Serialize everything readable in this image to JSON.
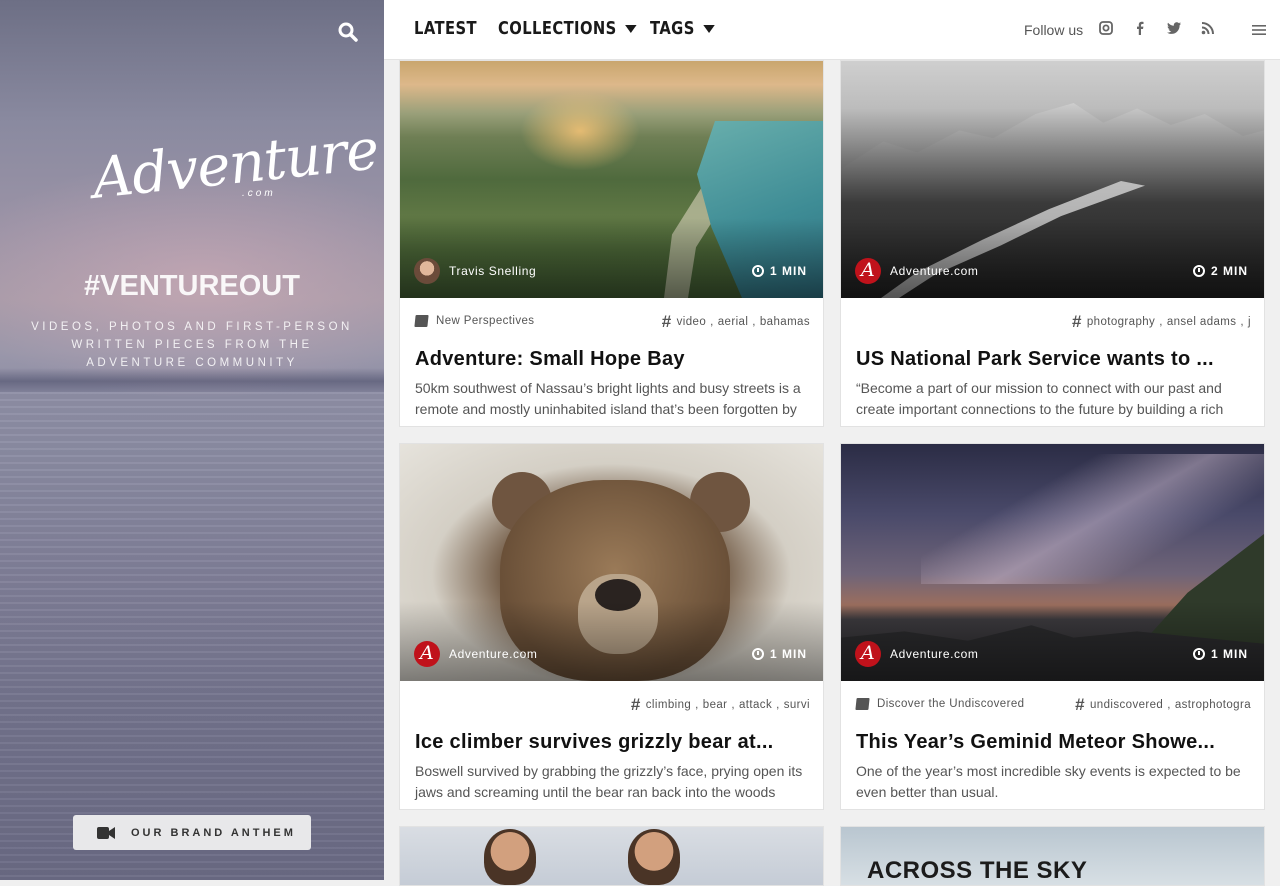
{
  "sidebar": {
    "logo_text": "Adventure",
    "logo_suffix": ".com",
    "tagline": "#VENTUREOUT",
    "subline": "VIDEOS, PHOTOS AND FIRST-PERSON WRITTEN PIECES FROM THE ADVENTURE COMMUNITY",
    "anthem_label": "OUR BRAND ANTHEM",
    "search_icon": "search-icon",
    "anthem_icon": "video-camera-icon"
  },
  "nav": {
    "latest": "LATEST",
    "collections": "COLLECTIONS",
    "tags": "TAGS",
    "follow": "Follow us",
    "social_icons": [
      "instagram-icon",
      "facebook-icon",
      "twitter-icon",
      "rss-icon"
    ],
    "menu_icon": "hamburger-icon"
  },
  "cards": [
    {
      "author": "Travis Snelling",
      "time": "1 MIN",
      "collection": "New Perspectives",
      "tags": [
        "video",
        "aerial",
        "bahamas"
      ],
      "title": "Adventure: Small Hope Bay",
      "excerpt": "50km southwest of Nassau’s bright lights and busy streets is a remote and mostly uninhabited island that’s been forgotten by"
    },
    {
      "author": "Adventure.com",
      "time": "2 MIN",
      "collection": "",
      "tags": [
        "photography",
        "ansel adams",
        "j"
      ],
      "title": "US National Park Service wants to ...",
      "excerpt": "“Become a part of our mission to connect with our past and create important connections to the future by building a rich"
    },
    {
      "author": "Adventure.com",
      "time": "1 MIN",
      "collection": "",
      "tags": [
        "climbing",
        "bear",
        "attack",
        "survi"
      ],
      "title": "Ice climber survives grizzly bear at...",
      "excerpt": "Boswell survived by grabbing the grizzly’s face, prying open its jaws and screaming until the bear ran back into the woods"
    },
    {
      "author": "Adventure.com",
      "time": "1 MIN",
      "collection": "Discover the Undiscovered",
      "tags": [
        "undiscovered",
        "astrophotogra"
      ],
      "title": "This Year’s Geminid Meteor Showe...",
      "excerpt": "One of the year’s most incredible sky events is expected to be even better than usual."
    }
  ],
  "bottom_cards": [
    {
      "headline": ""
    },
    {
      "headline": "ACROSS THE SKY"
    }
  ],
  "colors": {
    "brand_red": "#c0121b",
    "nav_text": "#1a1a1a",
    "body_text": "#555555"
  }
}
